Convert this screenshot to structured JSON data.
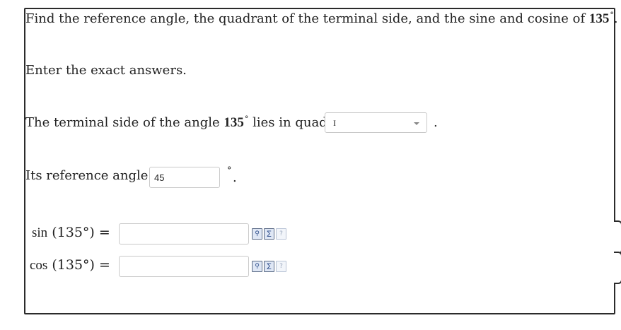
{
  "question": {
    "prompt_prefix": "Find the reference angle, the quadrant of the terminal side, and the sine and cosine of",
    "angle": "135",
    "degree_symbol": "°",
    "prompt_suffix": "."
  },
  "instructions": "Enter the exact answers.",
  "quadrant": {
    "label_prefix": "The terminal side of the angle",
    "angle": "135",
    "label_mid": "lies in quadrant",
    "selected": "I",
    "period": "."
  },
  "reference": {
    "label": "Its reference angle is",
    "value": "45",
    "degree_symbol": "°",
    "period": "."
  },
  "sin_row": {
    "fn": "sin",
    "expr": "(135°) =",
    "value": ""
  },
  "cos_row": {
    "fn": "cos",
    "expr": "(135°) =",
    "value": ""
  },
  "icons": {
    "preview": "preview-icon",
    "editor": "equation-editor-icon",
    "help": "help-icon"
  }
}
